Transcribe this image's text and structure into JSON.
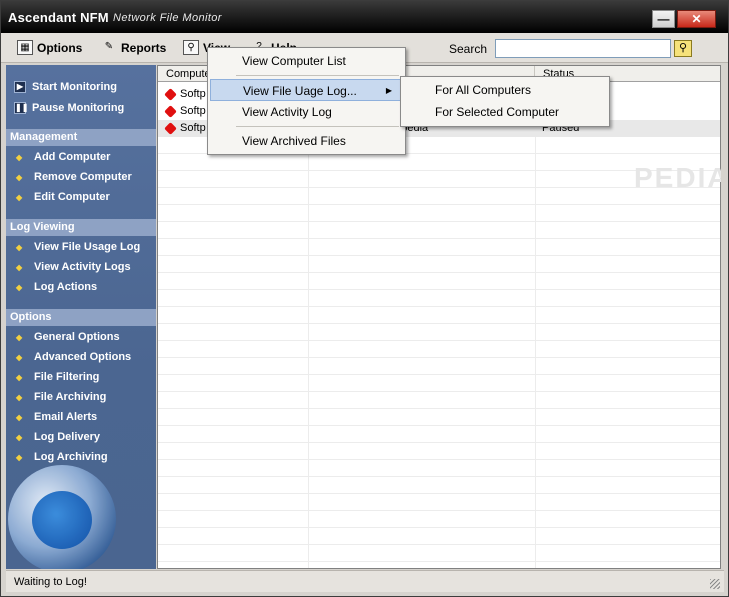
{
  "window": {
    "app_name": "Ascendant NFM",
    "subtitle": "Network File Monitor",
    "minimize_icon": "minimize-icon",
    "close_icon": "close-icon"
  },
  "toolbar": {
    "options_label": "Options",
    "reports_label": "Reports",
    "view_label": "View",
    "help_label": "Help",
    "search_label": "Search",
    "search_value": "",
    "search_button_icon": "search-icon"
  },
  "sidebar": {
    "top_items": [
      {
        "label": "Start Monitoring",
        "icon": "play-icon"
      },
      {
        "label": "Pause Monitoring",
        "icon": "pause-icon"
      }
    ],
    "sections": [
      {
        "title": "Management",
        "items": [
          "Add Computer",
          "Remove Computer",
          "Edit Computer"
        ]
      },
      {
        "title": "Log Viewing",
        "items": [
          "View File Usage Log",
          "View Activity Logs",
          "Log Actions"
        ]
      },
      {
        "title": "Options",
        "items": [
          "General Options",
          "Advanced Options",
          "File Filtering",
          "File Archiving",
          "Email Alerts",
          "Log Delivery",
          "Log Archiving"
        ]
      }
    ]
  },
  "list": {
    "columns": [
      "Computer",
      "",
      "Status"
    ],
    "rows": [
      {
        "computer": "Softp",
        "middle": "",
        "status": ""
      },
      {
        "computer": "Softp",
        "middle": "",
        "status": ""
      },
      {
        "computer": "Softp",
        "middle": "oftpedia",
        "status": "Paused"
      }
    ],
    "watermark": "PEDIA"
  },
  "view_menu": {
    "items": [
      {
        "label": "View Computer List"
      },
      {
        "label": "View File Uage Log...",
        "has_submenu": true,
        "highlighted": true
      },
      {
        "label": "View Activity Log"
      },
      {
        "label": "View Archived Files"
      }
    ]
  },
  "submenu": {
    "items": [
      "For All Computers",
      "For Selected Computer"
    ]
  },
  "status": {
    "text": "Waiting to Log!"
  },
  "colors": {
    "sidebar_bg": "#4b6691",
    "section_header": "#8ea2c4",
    "bullet": "#f2d040",
    "status_dot": "#e01010",
    "menu_highlight": "#c8d9ef"
  }
}
